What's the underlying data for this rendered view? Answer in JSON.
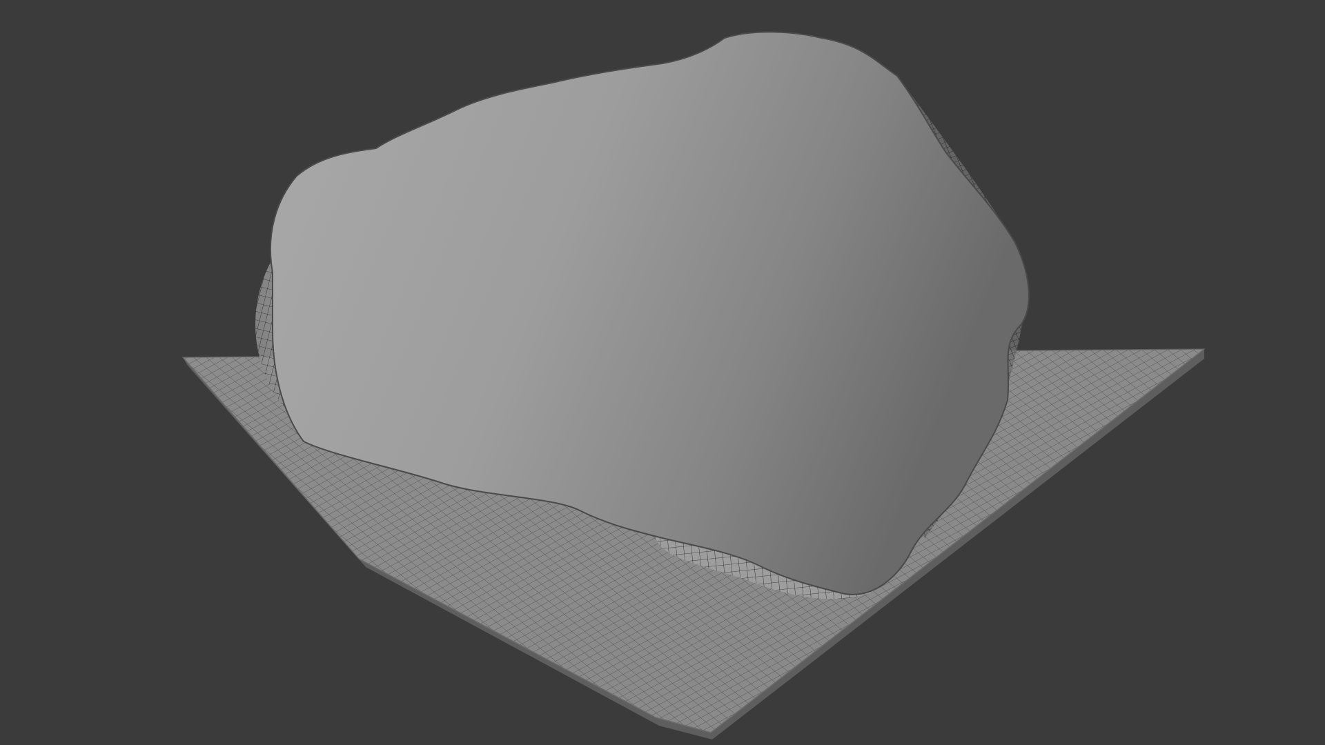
{
  "viewport": {
    "background_color": "#3b3b3b",
    "object": "rock-on-ground-plane",
    "display_mode": "wireframe-overlay",
    "mesh_color": "#9b9b9b",
    "wire_color": "#202020"
  }
}
